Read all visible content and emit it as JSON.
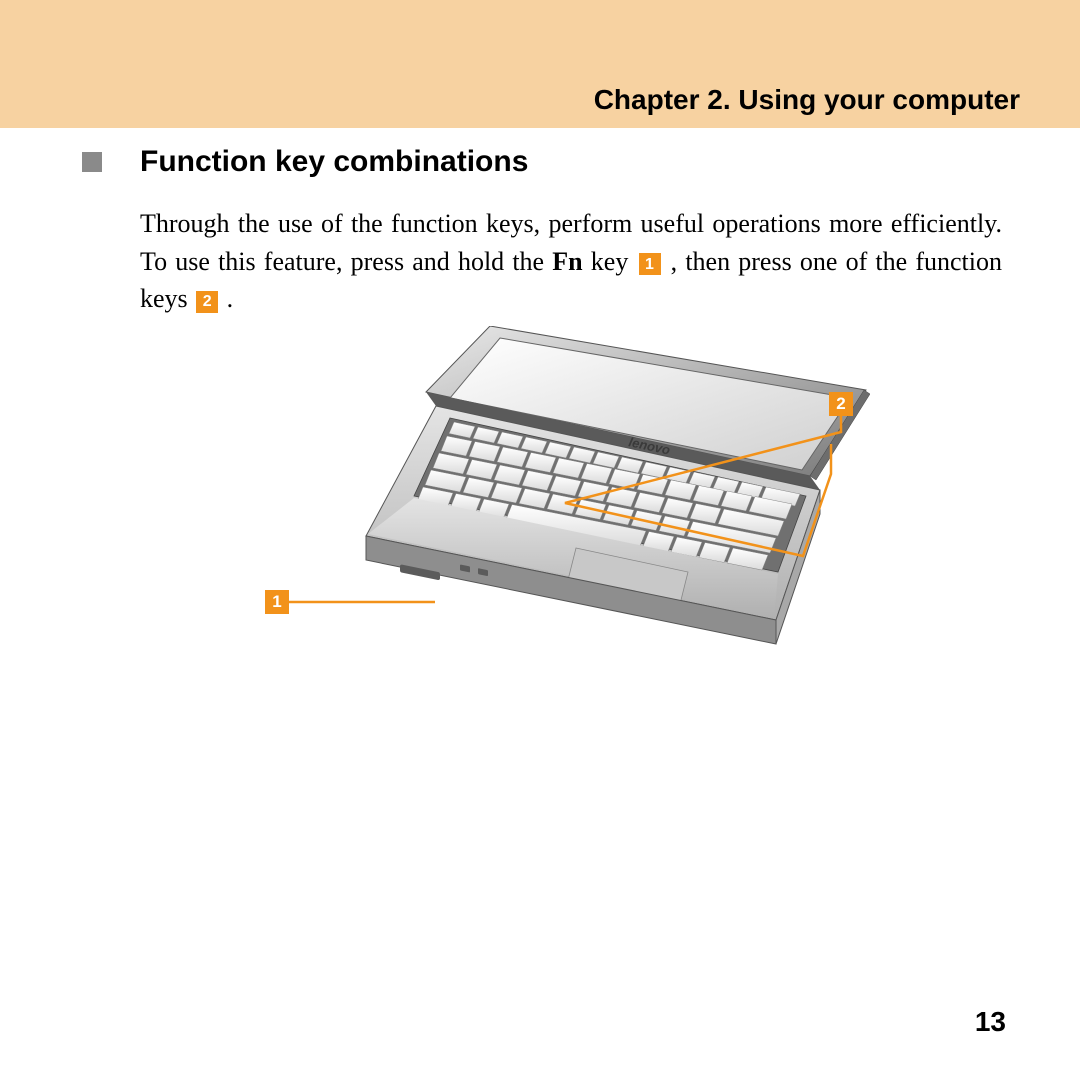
{
  "header": {
    "chapter_title": "Chapter 2. Using your computer"
  },
  "section": {
    "title": "Function key combinations",
    "para_part1": "Through the use of the function keys, perform useful operations more efficiently. To use this feature, press and hold the ",
    "fn_label": "Fn",
    "para_part2": " key ",
    "callout1": "1",
    "para_part3": " , then press one of the function keys ",
    "callout2": "2",
    "para_part4": " ."
  },
  "figure": {
    "brand": "lenovo",
    "callout_a": "1",
    "callout_b": "2"
  },
  "page_number": "13"
}
